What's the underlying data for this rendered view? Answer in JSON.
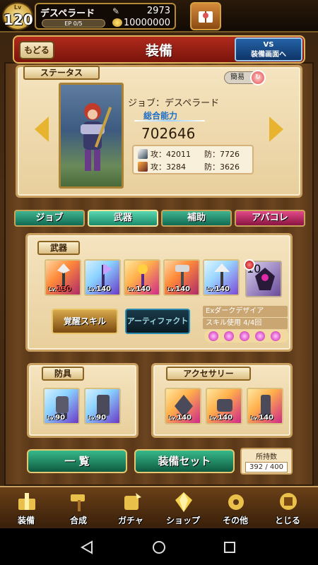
{
  "status_bar": {
    "level_label": "Lv",
    "level": "120",
    "player_name": "デスペラード",
    "ep_text": "EP 0/5",
    "stamina": "2973",
    "gold": "10000000"
  },
  "header": {
    "back_label": "もどる",
    "title": "装備",
    "vs_label_line1": "VS",
    "vs_label_line2": "装備画面へ"
  },
  "status_panel": {
    "section_label": "ステータス",
    "simple_label": "簡易",
    "job_line": "ジョブ：デスペラード",
    "ability_label": "総合能力",
    "ability_value": "702646",
    "attack1": "攻：42011",
    "defense1": "防：7726",
    "attack2": "攻：3284",
    "defense2": "防：3626"
  },
  "tabs": [
    {
      "label": "ジョブ"
    },
    {
      "label": "武器"
    },
    {
      "label": "補助"
    },
    {
      "label": "アバコレ"
    }
  ],
  "weapon_panel": {
    "section_label": "武器",
    "cards": [
      {
        "lv": "130"
      },
      {
        "lv": "140"
      },
      {
        "lv": "140"
      },
      {
        "lv": "140"
      },
      {
        "lv": "140"
      }
    ],
    "special_lv": "10",
    "awaken_label": "覚醒スキル",
    "artifact_label": "アーティファクト",
    "skill_name": "Exダークデザイア",
    "skill_count": "スキル使用 4/4回"
  },
  "armor_panel": {
    "section_label": "防具",
    "cards": [
      {
        "lv": "90"
      },
      {
        "lv": "90"
      }
    ]
  },
  "accessory_panel": {
    "section_label": "アクセサリー",
    "cards": [
      {
        "lv": "140"
      },
      {
        "lv": "140"
      },
      {
        "lv": "140"
      }
    ]
  },
  "actions": {
    "list_label": "一 覧",
    "set_label": "装備セット",
    "count_label": "所持数",
    "count_value": "392 / 400"
  },
  "nav": [
    {
      "label": "装備",
      "icon": "equip-icon"
    },
    {
      "label": "合成",
      "icon": "hammer-icon"
    },
    {
      "label": "ガチャ",
      "icon": "gacha-icon"
    },
    {
      "label": "ショップ",
      "icon": "crystal-icon"
    },
    {
      "label": "その他",
      "icon": "gear-icon"
    },
    {
      "label": "とじる",
      "icon": "close-icon"
    }
  ],
  "colors": {
    "accent": "#b02a1c",
    "tab_green": "#1a8a6a",
    "tab_pink": "#c8286a",
    "wood": "#5a3818"
  }
}
